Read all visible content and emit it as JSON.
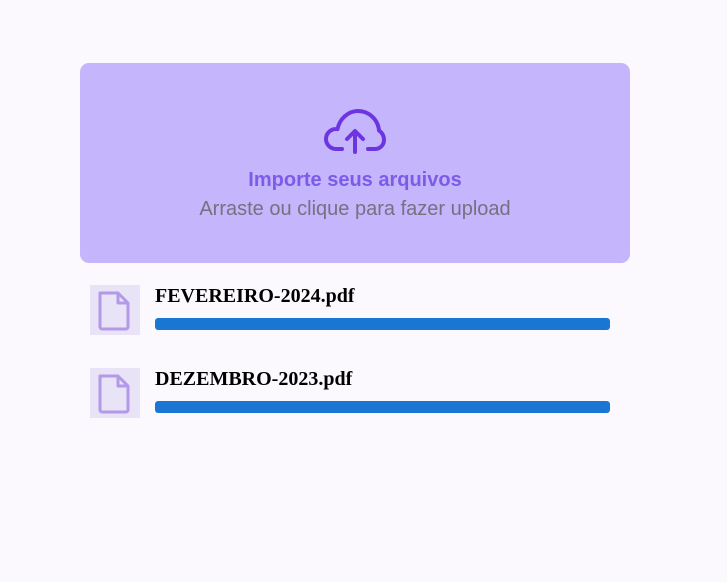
{
  "upload": {
    "icon": "cloud-upload-icon",
    "title": "Importe seus arquivos",
    "subtitle": "Arraste ou clique para fazer upload"
  },
  "files": [
    {
      "name": "FEVEREIRO-2024.pdf",
      "icon": "file-icon",
      "progress": 1.0
    },
    {
      "name": "DEZEMBRO-2023.pdf",
      "icon": "file-icon",
      "progress": 1.0
    }
  ],
  "colors": {
    "background": "#fbf9fd",
    "dropzone": "#c4b5fd",
    "accent": "#7c5ce6",
    "icon": "#6d35e0",
    "progress": "#1976d2",
    "file_thumb_bg": "#e9e3f8",
    "file_icon": "#b39ae8"
  }
}
